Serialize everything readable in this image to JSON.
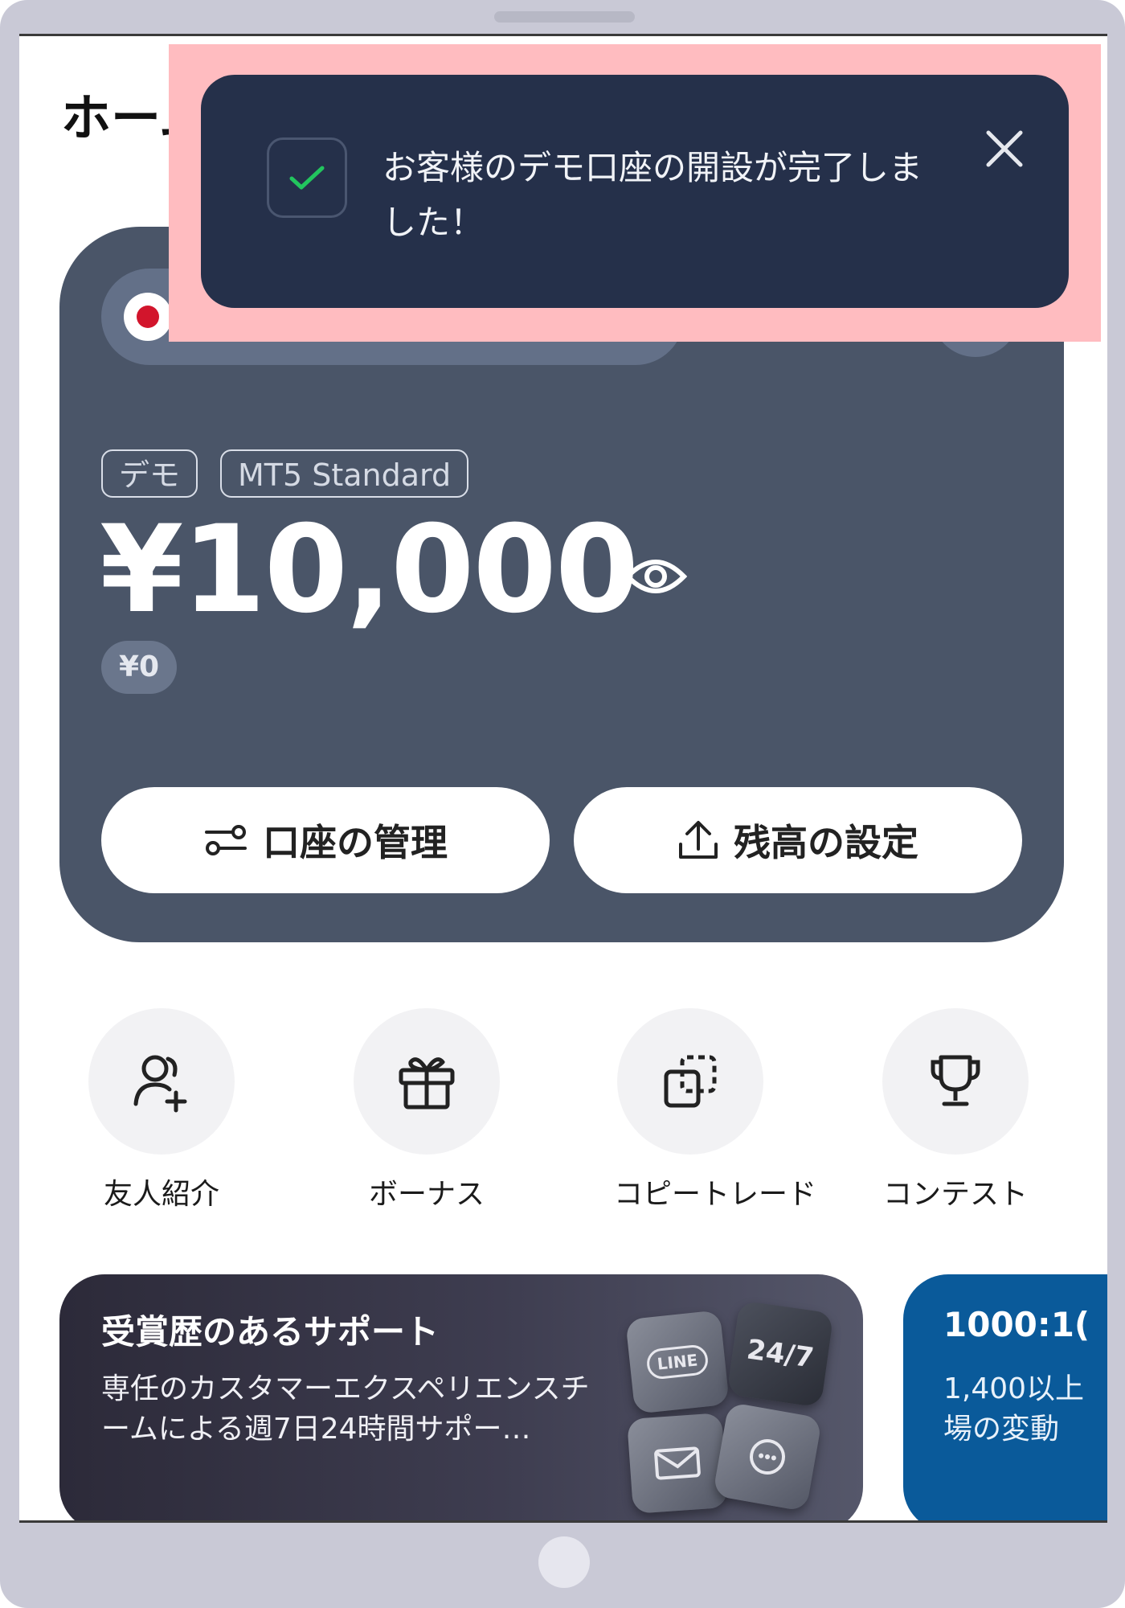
{
  "page": {
    "title": "ホーム"
  },
  "toast": {
    "message": "お客様のデモ口座の開設が完了しました！",
    "icon": "check-icon",
    "close_icon": "close-icon"
  },
  "account": {
    "tags": [
      "デモ",
      "MT5 Standard"
    ],
    "balance": "¥10,000",
    "sub_balance": "¥0",
    "buttons": {
      "manage": "口座の管理",
      "set_balance": "残高の設定"
    }
  },
  "quick_actions": [
    {
      "label": "友人紹介",
      "icon": "add-user-icon"
    },
    {
      "label": "ボーナス",
      "icon": "gift-icon"
    },
    {
      "label": "コピートレード",
      "icon": "copy-icon"
    },
    {
      "label": "コンテスト",
      "icon": "trophy-icon"
    }
  ],
  "promos": [
    {
      "title": "受賞歴のあるサポート",
      "text": "専任のカスタマーエクスペリエンスチームによる週7日24時間サポー…",
      "tiles": [
        "LINE",
        "24/7"
      ]
    },
    {
      "title": "1000:1(",
      "text_lines": [
        "1,400以上",
        "場の変動"
      ]
    }
  ],
  "colors": {
    "card": "#4a5568",
    "toast": "#25304a",
    "highlight": "#ffbcc0",
    "promo_blue": "#0a5a9a"
  }
}
